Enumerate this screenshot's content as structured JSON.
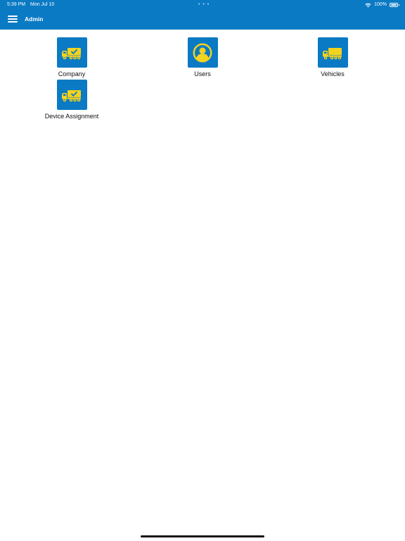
{
  "status_bar": {
    "time": "5:39 PM",
    "date": "Mon Jul 10",
    "dots": "• • •",
    "battery": "100%"
  },
  "header": {
    "title": "Admin",
    "menu_icon": "hamburger-icon"
  },
  "colors": {
    "primary": "#0a7ac4",
    "icon_yellow": "#f5d21e",
    "background": "#ffffff"
  },
  "tiles": [
    {
      "label": "Company",
      "icon": "truck-check-icon"
    },
    {
      "label": "Users",
      "icon": "user-avatar-icon"
    },
    {
      "label": "Vehicles",
      "icon": "truck-icon"
    },
    {
      "label": "Device Assignment",
      "icon": "truck-check-icon"
    }
  ]
}
